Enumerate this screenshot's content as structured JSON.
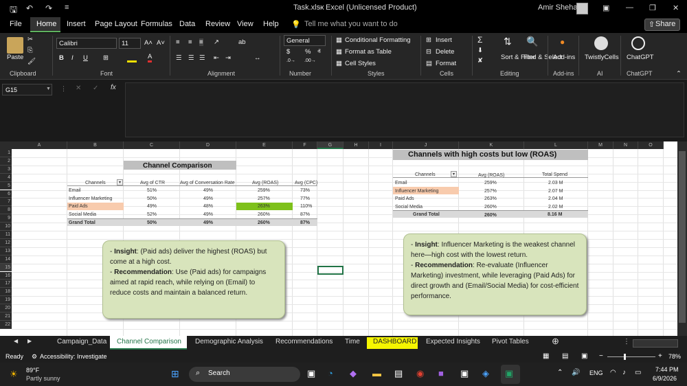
{
  "titlebar": {
    "filename": "Task.xlsx",
    "sep": "-",
    "app": "Excel (Unlicensed Product)",
    "user": "Amir Shehata"
  },
  "menu": {
    "file": "File",
    "home": "Home",
    "insert": "Insert",
    "page_layout": "Page Layout",
    "formulas": "Formulas",
    "data": "Data",
    "review": "Review",
    "view": "View",
    "help": "Help",
    "search": "Tell me what you want to do",
    "share": "Share"
  },
  "ribbon": {
    "paste": "Paste",
    "clipboard": "Clipboard",
    "font_name": "Calibri",
    "font_size": "11",
    "font_group": "Font",
    "alignment": "Alignment",
    "number_format": "General",
    "number": "Number",
    "cond_format": "Conditional Formatting",
    "format_table": "Format as Table",
    "cell_styles": "Cell Styles",
    "styles": "Styles",
    "insert": "Insert",
    "delete": "Delete",
    "format": "Format",
    "cells": "Cells",
    "sort_filter": "Sort & Filter",
    "find_select": "Find & Select",
    "editing": "Editing",
    "addins": "Add-ins",
    "addins_group": "Add-ins",
    "twistly": "TwistlyCells",
    "ai": "AI",
    "chatgpt": "ChatGPT",
    "chatgpt_group": "ChatGPT"
  },
  "namebox": "G15",
  "columns": [
    "A",
    "B",
    "C",
    "D",
    "E",
    "F",
    "G",
    "H",
    "I",
    "J",
    "K",
    "L",
    "M",
    "N",
    "O"
  ],
  "rows": [
    "1",
    "2",
    "3",
    "4",
    "5",
    "6",
    "7",
    "8",
    "9",
    "10",
    "11",
    "12",
    "13",
    "14",
    "15",
    "16",
    "17",
    "18",
    "19",
    "20",
    "21",
    "22"
  ],
  "table1": {
    "title": "Channel Comparison",
    "headers": [
      "Channels",
      "Avg of CTR",
      "Avg of Conversation Rate",
      "Avg (ROAS)",
      "Avg (CPC)"
    ],
    "rows": [
      [
        "Email",
        "51%",
        "49%",
        "259%",
        "73%"
      ],
      [
        "Influencer Marketing",
        "50%",
        "49%",
        "257%",
        "77%"
      ],
      [
        "Paid Ads",
        "49%",
        "48%",
        "263%",
        "110%"
      ],
      [
        "Social Media",
        "52%",
        "49%",
        "260%",
        "87%"
      ]
    ],
    "total": [
      "Grand Total",
      "50%",
      "49%",
      "260%",
      "87%"
    ]
  },
  "table2": {
    "title": "Channels with high costs but low (ROAS)",
    "headers": [
      "Channels",
      "Avg (ROAS)",
      "Total Spend"
    ],
    "rows": [
      [
        "Email",
        "259%",
        "2.03 M"
      ],
      [
        "Influencer Marketing",
        "257%",
        "2.07 M"
      ],
      [
        "Paid Ads",
        "263%",
        "2.04 M"
      ],
      [
        "Social Media",
        "260%",
        "2.02 M"
      ]
    ],
    "total": [
      "Grand Total",
      "260%",
      "8.16 M"
    ]
  },
  "note1": {
    "l1_bold": "Insight",
    "l1": ": (Paid ads) deliver the highest (ROAS) but come at a high cost.",
    "l2_bold": "Recommendation",
    "l2": ": Use (Paid ads)  for campaigns aimed at rapid reach, while relying on (Email) to reduce costs and maintain a balanced return."
  },
  "note2": {
    "l1_bold": "Insight",
    "l1": ": Influencer Marketing is the weakest channel here—high cost with the lowest return.",
    "l2_bold": "Recommendation",
    "l2": ": Re-evaluate (Influencer Marketing) investment, while leveraging (Paid Ads) for direct growth and (Email/Social Media) for cost-efficient performance."
  },
  "sheets": [
    "Campaign_Data",
    "Channel Comparison",
    "Demographic Analysis",
    "Recommendations",
    "Time",
    "DASHBOARD",
    "Expected Insights",
    "Pivot Tables"
  ],
  "status": {
    "ready": "Ready",
    "accessibility": "Accessibility: Investigate",
    "zoom": "78%"
  },
  "taskbar": {
    "temp": "89°F",
    "weather": "Partly sunny",
    "search": "Search",
    "lang": "ENG",
    "time": "7:44 PM",
    "date": "6/9/2026"
  }
}
